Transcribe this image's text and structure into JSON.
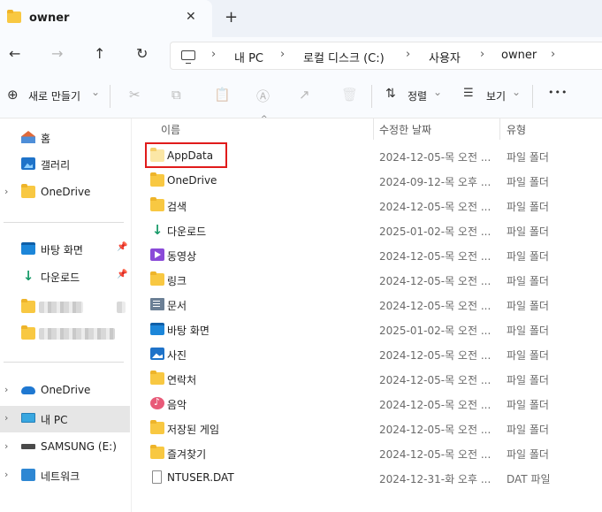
{
  "tab": {
    "title": "owner",
    "close": "✕",
    "new_tab": "+"
  },
  "nav": {
    "back": "←",
    "forward": "→",
    "up": "↑",
    "refresh": "↻"
  },
  "breadcrumb": [
    "내 PC",
    "로컬 디스크 (C:)",
    "사용자",
    "owner"
  ],
  "chevron": "›",
  "toolbar": {
    "new_label": "새로 만들기",
    "sort_label": "정렬",
    "view_label": "보기",
    "more": "•••",
    "caret": "⌄",
    "new_icon": "⊕",
    "sort_icon": "⇅",
    "view_icon": "☰",
    "cut_icon": "✂",
    "copy_icon": "⧉",
    "paste_icon": "📋",
    "rename_icon": "Ⓐ",
    "share_icon": "↗",
    "delete_icon": "🗑"
  },
  "sidebar": {
    "quick": [
      {
        "label": "홈",
        "icon": "home-icon"
      },
      {
        "label": "갤러리",
        "icon": "gallery-icon"
      },
      {
        "label": "OneDrive",
        "icon": "folder-icon"
      }
    ],
    "pinned": [
      {
        "label": "바탕 화면",
        "icon": "desktop-icon"
      },
      {
        "label": "다운로드",
        "icon": "download-icon"
      }
    ],
    "pin_glyph": "📌",
    "download_glyph": "↓",
    "locations": [
      {
        "label": "OneDrive",
        "icon": "cloud-icon"
      },
      {
        "label": "내 PC",
        "icon": "pc-icon"
      },
      {
        "label": "SAMSUNG (E:)",
        "icon": "drive-icon"
      },
      {
        "label": "네트워크",
        "icon": "network-icon"
      }
    ]
  },
  "columns": {
    "name": "이름",
    "date": "수정한 날짜",
    "type": "유형",
    "sort_arrow": "^"
  },
  "files": [
    {
      "name": "AppData",
      "date": "2024-12-05-목 오전 ...",
      "type": "파일 폴더",
      "icon": "folder-open-icon"
    },
    {
      "name": "OneDrive",
      "date": "2024-09-12-목 오후 ...",
      "type": "파일 폴더",
      "icon": "folder-icon"
    },
    {
      "name": "검색",
      "date": "2024-12-05-목 오전 ...",
      "type": "파일 폴더",
      "icon": "folder-icon"
    },
    {
      "name": "다운로드",
      "date": "2025-01-02-목 오전 ...",
      "type": "파일 폴더",
      "icon": "download-icon"
    },
    {
      "name": "동영상",
      "date": "2024-12-05-목 오전 ...",
      "type": "파일 폴더",
      "icon": "video-icon"
    },
    {
      "name": "링크",
      "date": "2024-12-05-목 오전 ...",
      "type": "파일 폴더",
      "icon": "folder-icon"
    },
    {
      "name": "문서",
      "date": "2024-12-05-목 오전 ...",
      "type": "파일 폴더",
      "icon": "document-icon"
    },
    {
      "name": "바탕 화면",
      "date": "2025-01-02-목 오전 ...",
      "type": "파일 폴더",
      "icon": "desktop-icon"
    },
    {
      "name": "사진",
      "date": "2024-12-05-목 오전 ...",
      "type": "파일 폴더",
      "icon": "photo-icon"
    },
    {
      "name": "연락처",
      "date": "2024-12-05-목 오전 ...",
      "type": "파일 폴더",
      "icon": "folder-icon"
    },
    {
      "name": "음악",
      "date": "2024-12-05-목 오전 ...",
      "type": "파일 폴더",
      "icon": "music-icon"
    },
    {
      "name": "저장된 게임",
      "date": "2024-12-05-목 오전 ...",
      "type": "파일 폴더",
      "icon": "folder-icon"
    },
    {
      "name": "즐겨찾기",
      "date": "2024-12-05-목 오전 ...",
      "type": "파일 폴더",
      "icon": "folder-icon"
    },
    {
      "name": "NTUSER.DAT",
      "date": "2024-12-31-화 오후 ...",
      "type": "DAT 파일",
      "icon": "file-icon"
    }
  ]
}
